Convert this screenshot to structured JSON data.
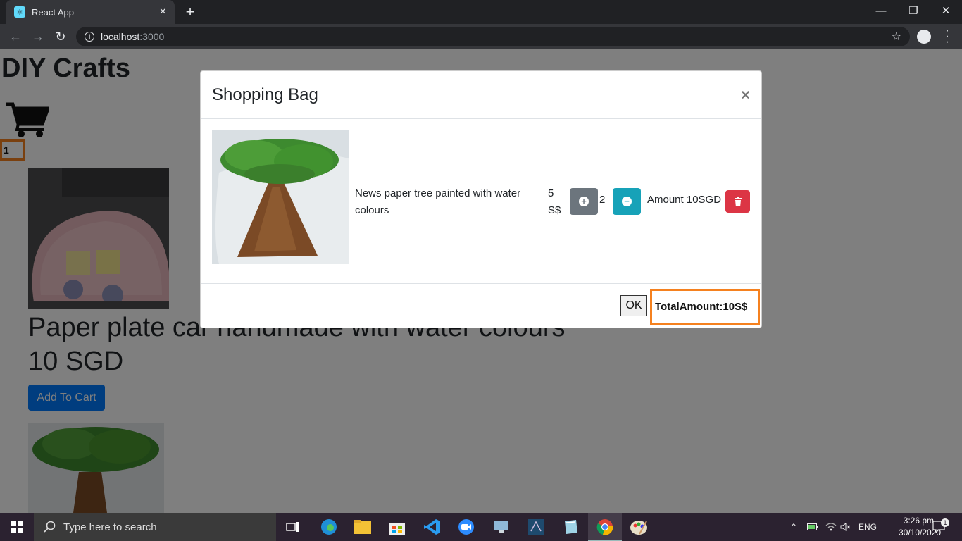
{
  "browser": {
    "tab_title": "React App",
    "tab_close": "×",
    "new_tab": "+",
    "url_host": "localhost",
    "url_port": ":3000",
    "window_minimize": "—",
    "window_restore": "❐",
    "window_close": "✕"
  },
  "page": {
    "site_title": "DIY Crafts",
    "cart_count": "1",
    "product1": {
      "title": "Paper plate car handmade with water colours",
      "price": "10 SGD",
      "add_button": "Add To Cart"
    }
  },
  "modal": {
    "title": "Shopping Bag",
    "close": "×",
    "item": {
      "name": "News paper tree painted with water colours",
      "price": "5 S$",
      "quantity": "2",
      "amount": "Amount 10SGD"
    },
    "ok_button": "OK",
    "total": "TotalAmount:10S$"
  },
  "taskbar": {
    "search_placeholder": "Type here to search",
    "language": "ENG",
    "time": "3:26 pm",
    "date": "30/10/2020",
    "notification_count": "1"
  },
  "colors": {
    "highlight": "#f5811f",
    "primary": "#007bff",
    "secondary": "#6c757d",
    "info": "#17a2b8",
    "danger": "#dc3545"
  }
}
